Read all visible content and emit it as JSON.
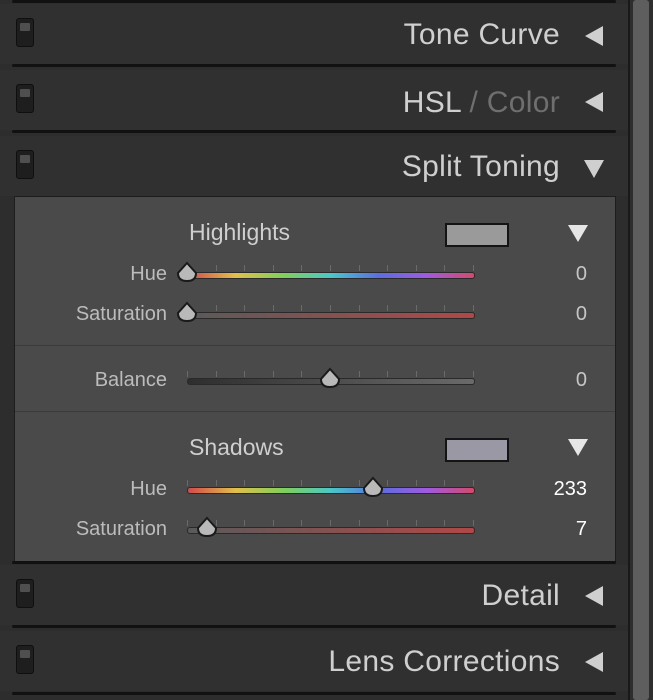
{
  "sections": {
    "tone_curve": {
      "title": "Tone Curve"
    },
    "hsl": {
      "title_main": "HSL",
      "title_sep": " / ",
      "title_dim": "Color"
    },
    "split_toning": {
      "title": "Split Toning"
    },
    "detail": {
      "title": "Detail"
    },
    "lens_corrections": {
      "title": "Lens Corrections"
    }
  },
  "split_toning": {
    "highlights": {
      "title": "Highlights",
      "swatch_color": "#9a9a9a",
      "hue_label": "Hue",
      "hue_value": "0",
      "saturation_label": "Saturation",
      "saturation_value": "0"
    },
    "balance": {
      "label": "Balance",
      "value": "0"
    },
    "shadows": {
      "title": "Shadows",
      "swatch_color": "#9a98a4",
      "hue_label": "Hue",
      "hue_value": "233",
      "saturation_label": "Saturation",
      "saturation_value": "7"
    }
  },
  "slider_positions": {
    "highlights_hue": 0,
    "highlights_saturation": 0,
    "balance": 0.5,
    "shadows_hue": 0.65,
    "shadows_saturation": 0.07
  }
}
